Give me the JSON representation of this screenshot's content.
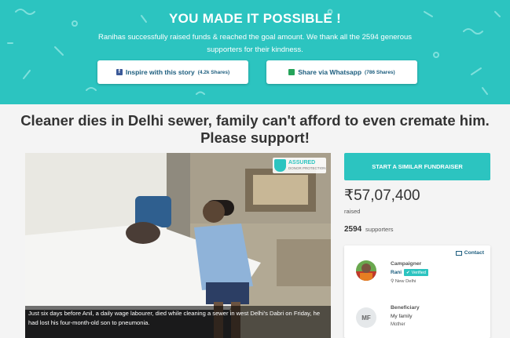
{
  "banner": {
    "heading": "YOU MADE IT POSSIBLE !",
    "message": "Ranihas successfully raised funds & reached the goal amount. We thank all the 2594 generous supporters for their kindness.",
    "fb_button": {
      "label": "Inspire with this story",
      "count": "(4.2k Shares)"
    },
    "wa_button": {
      "label": "Share via Whatsapp",
      "count": "(786 Shares)"
    }
  },
  "campaign": {
    "title": "Cleaner dies in Delhi sewer, family can't afford to even cremate him. Please support!",
    "badge_title": "ASSURED",
    "badge_sub": "DONOR PROTECTION",
    "caption": "Just six days before Anil, a daily wage labourer, died while cleaning a sewer in west Delhi's Dabri on Friday, he had lost his four-month-old son to pneumonia."
  },
  "sidebar": {
    "cta": "START A SIMILAR FUNDRAISER",
    "amount": "₹57,07,400",
    "raised_label": "raised",
    "supporters_count": "2594",
    "supporters_label": "supporters"
  },
  "organizer": {
    "contact": "Contact",
    "campaigner_role": "Campaigner",
    "campaigner_name": "Rani",
    "verified": "Verified",
    "location": "New Delhi",
    "beneficiary_role": "Beneficiary",
    "beneficiary_initials": "MF",
    "beneficiary_name": "My family",
    "relation": "Mother"
  },
  "colors": {
    "brand": "#2cc4c0",
    "link": "#1c5d7e"
  }
}
